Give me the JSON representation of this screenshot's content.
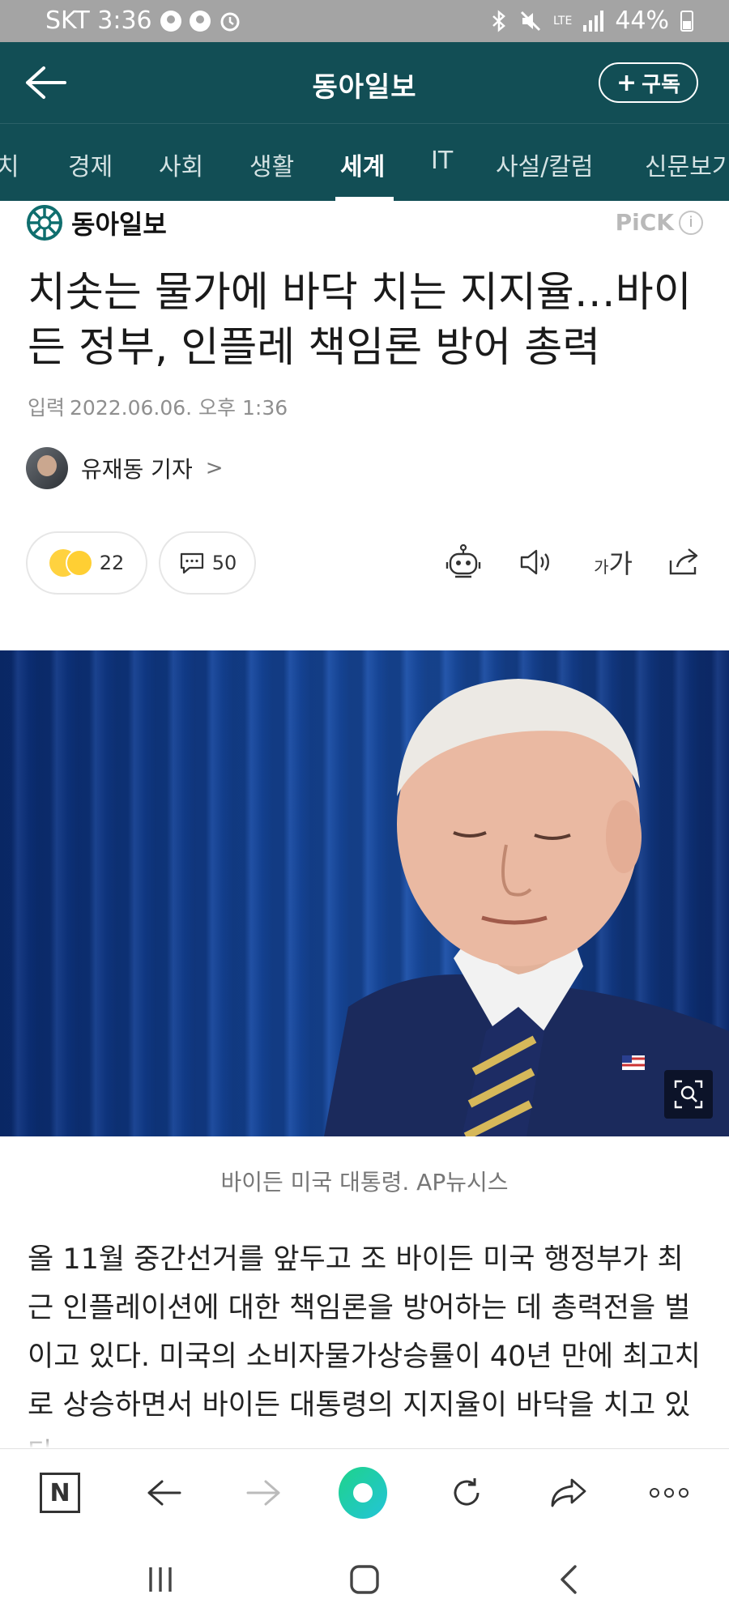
{
  "status_bar": {
    "carrier_time": "SKT 3:36",
    "network": "LTE",
    "battery": "44%"
  },
  "header": {
    "title": "동아일보",
    "subscribe_label": "구독",
    "subscribe_plus": "+"
  },
  "tabs": [
    {
      "label": "치"
    },
    {
      "label": "경제"
    },
    {
      "label": "사회"
    },
    {
      "label": "생활"
    },
    {
      "label": "세계",
      "active": true
    },
    {
      "label": "IT"
    },
    {
      "label": "사설/칼럼"
    },
    {
      "label": "신문보기"
    }
  ],
  "article": {
    "press_name": "동아일보",
    "pick_label": "PiCK",
    "pick_info": "i",
    "headline": "치솟는 물가에 바닥 치는 지지율…바이든 정부, 인플레 책임론 방어 총력",
    "date_label": "입력",
    "date_value": "2022.06.06. 오후 1:36",
    "author": "유재동 기자",
    "author_chevron": ">",
    "reactions_count": "22",
    "comments_count": "50",
    "font_size_small": "가",
    "font_size_large": "가",
    "photo_caption": "바이든 미국 대통령. AP뉴시스",
    "body": "올 11월 중간선거를 앞두고 조 바이든 미국 행정부가 최근 인플레이션에 대한 책임론을 방어하는 데 총력전을 벌이고 있다. 미국의 소비자물가상승률이 40년 만에 최고치로 상승하면서 바이든 대통령의 지지율이 바닥을 치고 있다."
  },
  "browser_toolbar": {
    "n_label": "N"
  },
  "colors": {
    "header_bg": "#124e55",
    "accent_green": "#1ed38a"
  }
}
